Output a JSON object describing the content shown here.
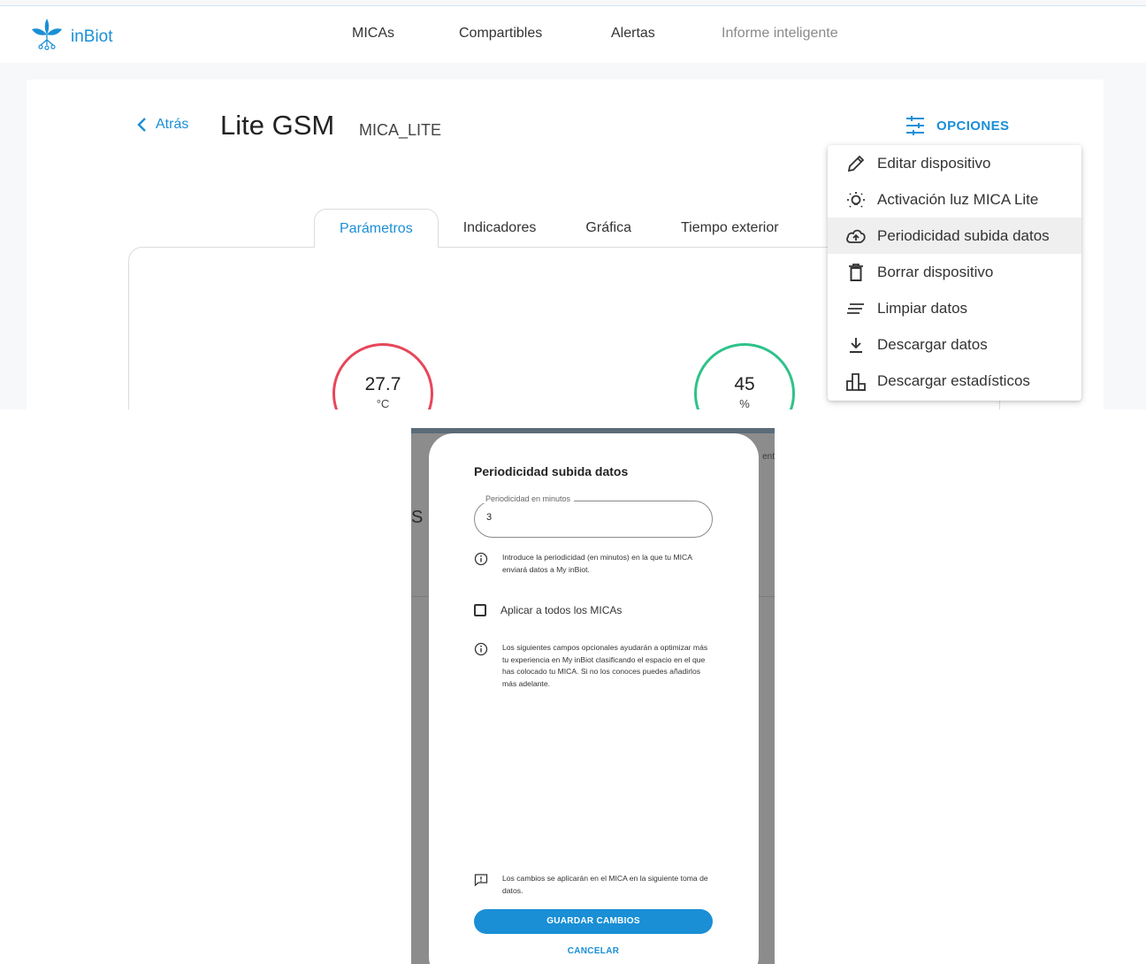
{
  "brand": {
    "name": "inBiot",
    "color": "#1a8fd6"
  },
  "nav": {
    "items": [
      {
        "label": "MICAs"
      },
      {
        "label": "Compartibles"
      },
      {
        "label": "Alertas"
      },
      {
        "label": "Informe inteligente"
      }
    ]
  },
  "device": {
    "back_label": "Atrás",
    "title": "Lite GSM",
    "subtitle": "MICA_LITE",
    "options_label": "OPCIONES"
  },
  "tabs": [
    {
      "label": "Parámetros",
      "active": true
    },
    {
      "label": "Indicadores"
    },
    {
      "label": "Gráfica"
    },
    {
      "label": "Tiempo exterior"
    }
  ],
  "gauges": [
    {
      "value": "27.7",
      "unit": "°C",
      "color": "#e8465a"
    },
    {
      "value": "45",
      "unit": "%",
      "color": "#2ec28a"
    }
  ],
  "menu": {
    "items": [
      {
        "label": "Editar dispositivo",
        "icon": "pencil-icon"
      },
      {
        "label": "Activación luz MICA Lite",
        "icon": "light-bulb-icon"
      },
      {
        "label": "Periodicidad subida datos",
        "icon": "cloud-upload-icon",
        "highlighted": true
      },
      {
        "label": "Borrar dispositivo",
        "icon": "trash-icon"
      },
      {
        "label": "Limpiar datos",
        "icon": "clear-lines-icon"
      },
      {
        "label": "Descargar datos",
        "icon": "download-icon"
      },
      {
        "label": "Descargar estadísticos",
        "icon": "bar-chart-icon"
      }
    ]
  },
  "background": {
    "partial_text_1": "S",
    "partial_text_2": "ent"
  },
  "modal": {
    "title": "Periodicidad subida datos",
    "field_label": "Periodicidad en minutos",
    "field_value": "3",
    "info_1": "Introduce la periodicidad (en minutos) en la que tu MICA enviará datos a My inBiot.",
    "checkbox_label": "Aplicar a todos los MICAs",
    "info_2": "Los siguientes campos opcionales ayudarán a optimizar más tu experiencia en My inBiot clasificando el espacio en el que has colocado tu MICA. Si no los conoces puedes añadirlos más adelante.",
    "notice": "Los cambios se aplicarán en el MICA en la siguiente toma de datos.",
    "save_label": "GUARDAR CAMBIOS",
    "cancel_label": "CANCELAR"
  }
}
